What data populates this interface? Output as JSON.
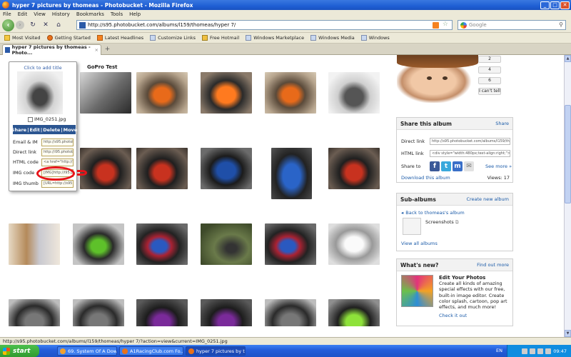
{
  "window": {
    "title": "hyper 7 pictures by thomeas - Photobucket - Mozilla Firefox"
  },
  "menu": [
    "File",
    "Edit",
    "View",
    "History",
    "Bookmarks",
    "Tools",
    "Help"
  ],
  "address": {
    "url": "http://s95.photobucket.com/albums/l159/thomeas/hyper 7/"
  },
  "search": {
    "placeholder": "Google"
  },
  "bookmarks": [
    "Most Visited",
    "Getting Started",
    "Latest Headlines",
    "Customize Links",
    "Free Hotmail",
    "Windows Marketplace",
    "Windows Media",
    "Windows"
  ],
  "tab": {
    "title": "hyper 7 pictures by thomeas - Photo..."
  },
  "album": {
    "gopro_caption": "GoPro Test"
  },
  "popup": {
    "click_to_add": "Click to add title",
    "filename": "IMG_0251.jpg",
    "actions": [
      "Share",
      "Edit",
      "Delete",
      "Move"
    ],
    "fields": [
      {
        "label": "Email & IM",
        "value": "http://s95.photobucket.com"
      },
      {
        "label": "Direct link",
        "value": "http://i95.photobucket.com"
      },
      {
        "label": "HTML code",
        "value": "<a href=\"http://s95"
      },
      {
        "label": "IMG code",
        "value": "[IMG]http://i95.pho"
      },
      {
        "label": "IMG thumb",
        "value": "[URL=http://s95"
      }
    ]
  },
  "pagination": [
    "2",
    "4",
    "6",
    "I can't tell"
  ],
  "share": {
    "title": "Share this album",
    "share_link": "Share",
    "direct_label": "Direct link",
    "direct_value": "http://s95.photobucket.com/albums/l159/th",
    "html_label": "HTML link",
    "html_value": "<div style=\"width:480px;text-align:right;\"><",
    "share_to_label": "Share to",
    "see_more": "See more »",
    "download": "Download this album",
    "views": "Views: 17"
  },
  "subalbums": {
    "title": "Sub-albums",
    "create": "Create new album",
    "back": "Back to thomeas's album",
    "screenshots": "Screenshots",
    "view_all": "View all albums"
  },
  "whatsnew": {
    "title": "What's new?",
    "find_out": "Find out more",
    "heading": "Edit Your Photos",
    "body": "Create all kinds of amazing special effects with our free, built-in image editor. Create color splash, cartoon, pop art effects, and much more!",
    "check": "Check it out"
  },
  "status": {
    "text": "http://s95.photobucket.com/albums/l159/thomeas/hyper 7/?action=view&current=IMG_0251.jpg"
  },
  "taskbar": {
    "start": "start",
    "tasks": [
      "69. System Of A Dow...",
      "A1RacingClub.com Fo...",
      "hyper 7 pictures by t..."
    ],
    "lang": "EN",
    "clock": "09:47"
  }
}
